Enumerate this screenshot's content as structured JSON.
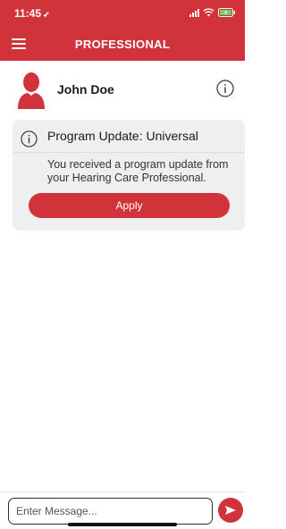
{
  "status_bar": {
    "time": "11:45",
    "location_icon": "location-arrow-icon",
    "signal_icon": "cellular-signal-icon",
    "wifi_icon": "wifi-icon",
    "battery_icon": "battery-charging-icon"
  },
  "header": {
    "title": "PROFESSIONAL",
    "menu_icon": "hamburger-menu-icon"
  },
  "profile": {
    "name": "John Doe",
    "avatar_icon": "person-avatar-icon",
    "info_icon": "info-icon"
  },
  "notification": {
    "icon": "info-icon",
    "title": "Program Update: Universal",
    "body": "You received a program update from your Hearing Care Professional.",
    "button_label": "Apply"
  },
  "composer": {
    "placeholder": "Enter Message...",
    "send_icon": "send-arrow-icon"
  },
  "colors": {
    "accent": "#d0343a",
    "card_background": "#efefef",
    "text": "#1a1a1a"
  }
}
